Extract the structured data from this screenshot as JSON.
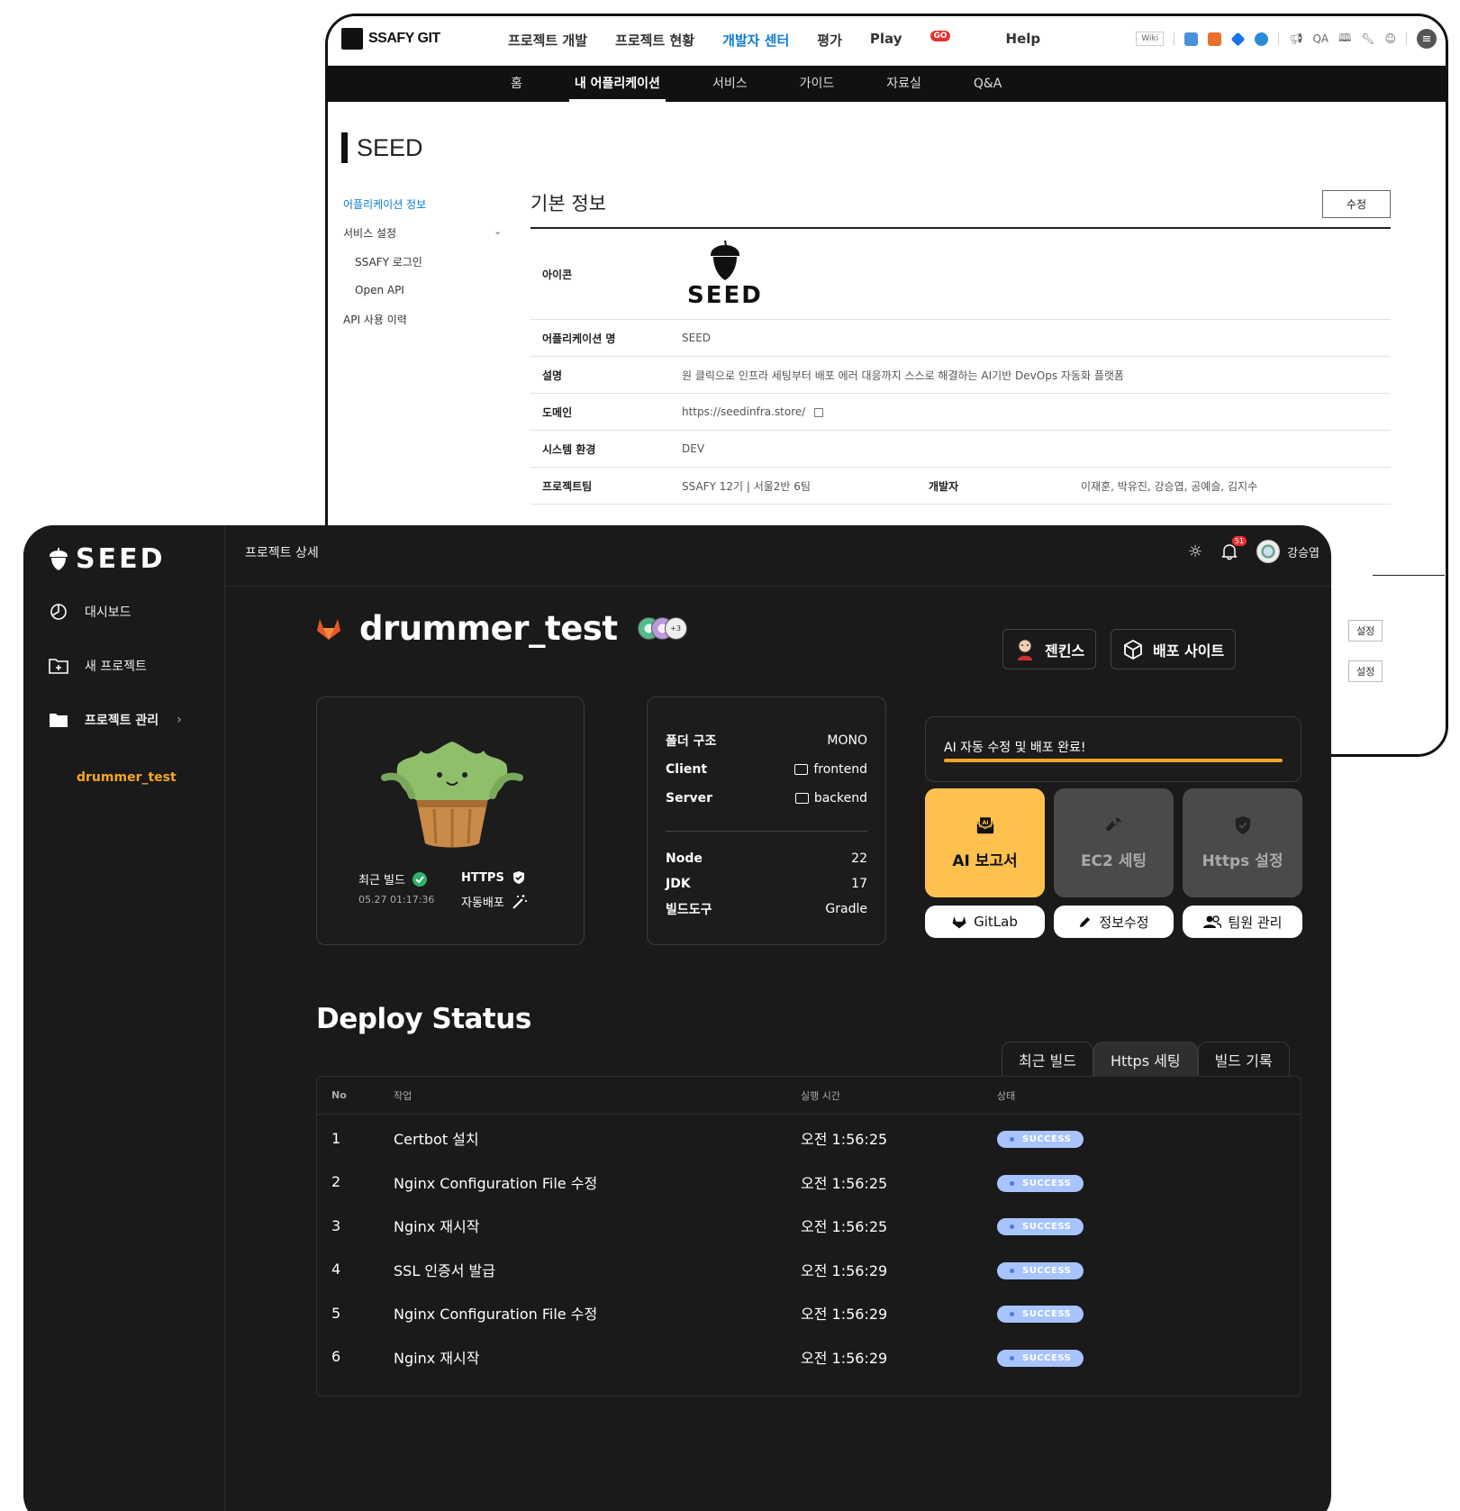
{
  "back_window": {
    "logo_text": "SSAFY GIT",
    "menu": [
      "프로젝트 개발",
      "프로젝트 현황",
      "개발자 센터",
      "평가",
      "Play",
      "Help"
    ],
    "menu_active_index": 2,
    "play_badge": "GO",
    "tools": {
      "wiki": "Wiki",
      "qa": "QA"
    },
    "subnav": [
      "홈",
      "내 어플리케이션",
      "서비스",
      "가이드",
      "자료실",
      "Q&A"
    ],
    "subnav_active_index": 1,
    "app_title": "SEED",
    "sidebar": {
      "app_info": "어플리케이션 정보",
      "service_settings": "서비스 설정",
      "ssafy_login": "SSAFY 로그인",
      "open_api": "Open API",
      "api_history": "API 사용 이력"
    },
    "section_title": "기본 정보",
    "edit_button": "수정",
    "rows": {
      "icon_label": "아이콘",
      "icon_word": "SEED",
      "app_name_label": "어플리케이션 명",
      "app_name": "SEED",
      "desc_label": "설명",
      "desc": "원 클릭으로 인프라 세팅부터 배포 에러 대응까지 스스로 해결하는 AI기반 DevOps 자동화 플랫폼",
      "domain_label": "도메인",
      "domain": "https://seedinfra.store/",
      "env_label": "시스템 환경",
      "env": "DEV",
      "team_label": "프로젝트팀",
      "team": "SSAFY 12기 | 서울2반 6팀",
      "dev_label": "개발자",
      "devs": "이재훈, 박유진, 강승엽, 공예슬, 김지수"
    },
    "setting_button": "설정"
  },
  "front_window": {
    "brand": "SEED",
    "nav": {
      "dashboard": "대시보드",
      "new_project": "새 프로젝트",
      "manage": "프로젝트 관리",
      "current_project": "drummer_test"
    },
    "page_title": "프로젝트 상세",
    "notif_count": "51",
    "user_name": "강승엽",
    "project_name": "drummer_test",
    "member_more": "+3",
    "jenkins_button": "젠킨스",
    "deploy_site_button": "배포 사이트",
    "status_card": {
      "recent_build_label": "최근 빌드",
      "recent_build_time": "05.27 01:17:36",
      "https_label": "HTTPS",
      "auto_deploy_label": "자동배포"
    },
    "info_card": {
      "folder_label": "폴더 구조",
      "folder_value": "MONO",
      "client_label": "Client",
      "client_value": "frontend",
      "server_label": "Server",
      "server_value": "backend",
      "node_label": "Node",
      "node_value": "22",
      "jdk_label": "JDK",
      "jdk_value": "17",
      "build_tool_label": "빌드도구",
      "build_tool_value": "Gradle"
    },
    "ai_status": "AI 자동 수정 및 배포 완료!",
    "ai_progress": 1.0,
    "tiles": {
      "ai_report": "AI 보고서",
      "ec2": "EC2 세팅",
      "https": "Https 설정",
      "ai_icon_text": "AI"
    },
    "pills": {
      "gitlab": "GitLab",
      "edit": "정보수정",
      "team": "팀원 관리"
    },
    "deploy_title": "Deploy Status",
    "tabs": [
      "최근 빌드",
      "Https 세팅",
      "빌드 기록"
    ],
    "tab_active_index": 1,
    "table": {
      "headers": [
        "No",
        "작업",
        "실행 시간",
        "상태"
      ],
      "rows": [
        {
          "no": "1",
          "task": "Certbot 설치",
          "time": "오전 1:56:25",
          "status": "SUCCESS"
        },
        {
          "no": "2",
          "task": "Nginx Configuration File 수정",
          "time": "오전 1:56:25",
          "status": "SUCCESS"
        },
        {
          "no": "3",
          "task": "Nginx 재시작",
          "time": "오전 1:56:25",
          "status": "SUCCESS"
        },
        {
          "no": "4",
          "task": "SSL 인증서 발급",
          "time": "오전 1:56:29",
          "status": "SUCCESS"
        },
        {
          "no": "5",
          "task": "Nginx Configuration File 수정",
          "time": "오전 1:56:29",
          "status": "SUCCESS"
        },
        {
          "no": "6",
          "task": "Nginx 재시작",
          "time": "오전 1:56:29",
          "status": "SUCCESS"
        }
      ]
    },
    "colors": {
      "accent": "#f5a623",
      "success": "#a8c4ff",
      "ai_tile": "#ffc14d",
      "bg": "#1a1a1a"
    }
  }
}
